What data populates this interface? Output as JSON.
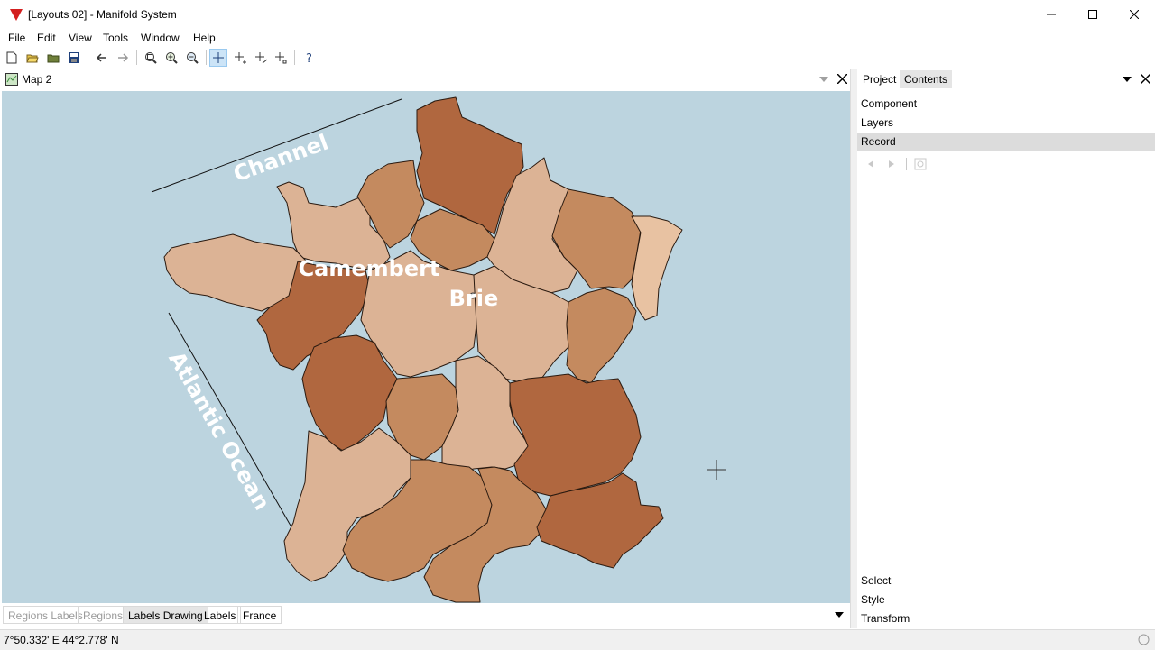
{
  "window": {
    "title": "[Layouts 02] - Manifold System"
  },
  "menu": [
    "File",
    "Edit",
    "View",
    "Tools",
    "Window",
    "Help"
  ],
  "toolbar": {
    "icons": [
      "new-icon",
      "open-icon",
      "open-folder-icon",
      "save-icon",
      "back-icon",
      "forward-icon",
      "zoom-to-fit-icon",
      "zoom-in-icon",
      "zoom-out-icon",
      "pointer-icon",
      "add-point-icon",
      "add-line-icon",
      "add-area-icon",
      "help-icon"
    ]
  },
  "map_window": {
    "tab_label": "Map 2",
    "labels": {
      "channel": "Channel",
      "camembert": "Camembert",
      "brie": "Brie",
      "atlantic": "Atlantic Ocean"
    },
    "layer_tabs": [
      "Regions Labels",
      "Regions",
      "Labels Drawing",
      "Labels",
      "France"
    ]
  },
  "panel": {
    "tabs": [
      "Project",
      "Contents"
    ],
    "sections_top": [
      "Component",
      "Layers",
      "Record"
    ],
    "sections_bottom": [
      "Select",
      "Style",
      "Transform"
    ]
  },
  "status": {
    "coords": "7°50.332' E 44°2.778' N"
  },
  "colors": {
    "water": "#bcd4df",
    "region_light": "#dcb395",
    "region_medium": "#c48a5f",
    "region_dark": "#b0673f"
  }
}
